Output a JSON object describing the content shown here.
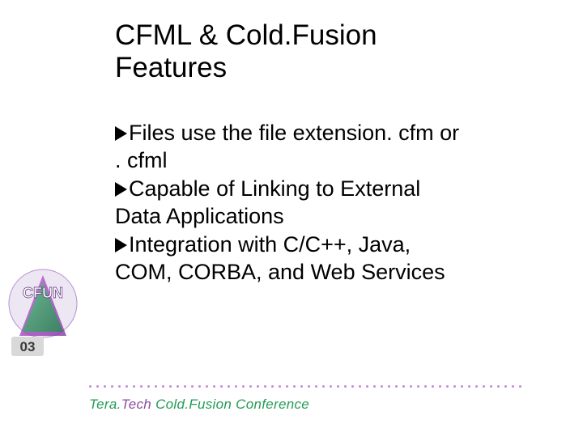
{
  "title_line1": "CFML & Cold.Fusion",
  "title_line2": "Features",
  "bullets": {
    "b1a": "Files use the file extension. cfm or",
    "b1b": ". cfml",
    "b2a": "Capable of Linking to External",
    "b2b": "Data Applications",
    "b3a": "Integration with C/C++, Java,",
    "b3b": "COM, CORBA, and Web Services"
  },
  "footer": {
    "brand1": "Tera.",
    "brand2": "Tech ",
    "rest": "Cold.Fusion Conference"
  },
  "logo_label": "CFUN 03"
}
